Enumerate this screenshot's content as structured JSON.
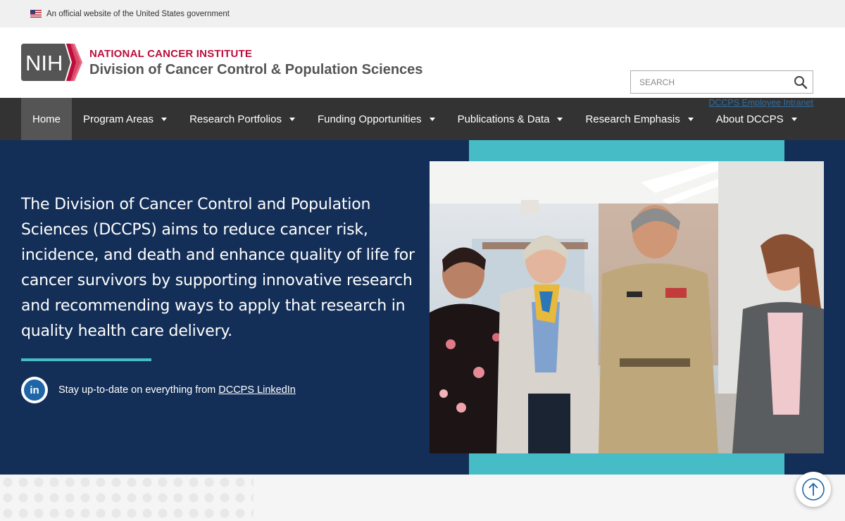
{
  "gov_banner": {
    "text": "An official website of the United States government",
    "flag_icon": "us-flag-icon"
  },
  "header": {
    "logo_badge": "NIH",
    "institute_name": "NATIONAL CANCER INSTITUTE",
    "division_name": "Division of Cancer Control & Population Sciences",
    "search_placeholder": "SEARCH",
    "search_icon": "search-icon",
    "intranet_link": "DCCPS Employee Intranet"
  },
  "nav": {
    "items": [
      {
        "label": "Home",
        "active": true,
        "dropdown": false
      },
      {
        "label": "Program Areas",
        "dropdown": true
      },
      {
        "label": "Research Portfolios",
        "dropdown": true
      },
      {
        "label": "Funding Opportunities",
        "dropdown": true
      },
      {
        "label": "Publications & Data",
        "dropdown": true
      },
      {
        "label": "Research Emphasis",
        "dropdown": true
      },
      {
        "label": "About DCCPS",
        "dropdown": true
      }
    ]
  },
  "hero": {
    "mission": "The Division of Cancer Control and Population Sciences (DCCPS) aims to reduce cancer risk, incidence, and death and enhance quality of life for cancer survivors by supporting innovative research and recommending ways to apply that research in quality health care delivery.",
    "linkedin_prefix": "Stay up-to-date on everything from",
    "linkedin_link": "DCCPS LinkedIn",
    "linkedin_icon_text": "in"
  },
  "colors": {
    "hero_bg": "#142f57",
    "teal_accent": "#45bcc6",
    "nav_bg": "#333333",
    "nci_red": "#bb0e3d"
  },
  "back_to_top_icon": "arrow-up-icon"
}
